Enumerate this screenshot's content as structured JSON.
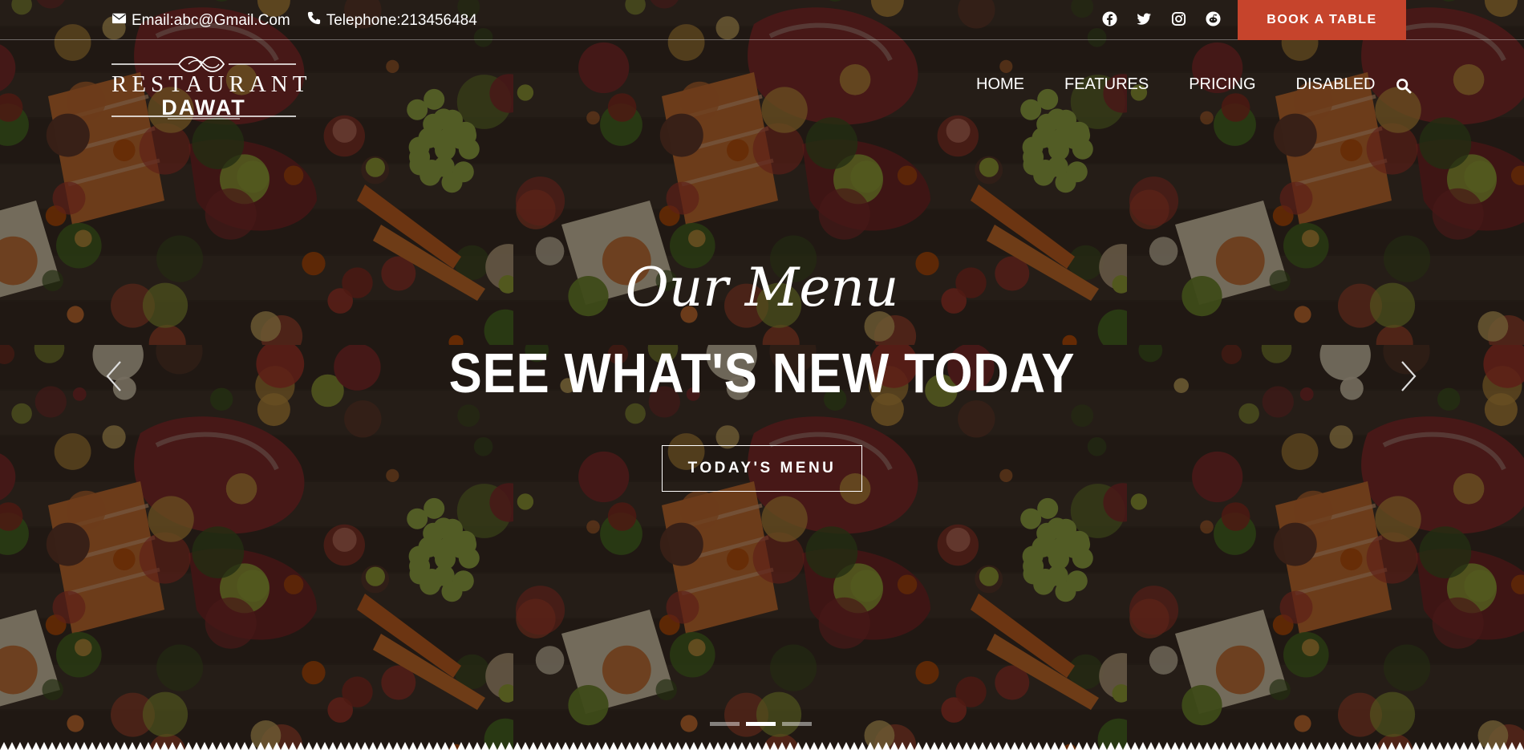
{
  "topbar": {
    "email_label": "Email:abc@Gmail.Com",
    "phone_label": "Telephone:213456484",
    "socials": [
      "facebook-icon",
      "twitter-icon",
      "instagram-icon",
      "reddit-icon"
    ],
    "book_label": "BOOK A TABLE"
  },
  "logo": {
    "line1": "RESTAURANT",
    "line2": "DAWAT"
  },
  "nav": {
    "items": [
      "HOME",
      "FEATURES",
      "PRICING",
      "DISABLED"
    ]
  },
  "hero": {
    "subtitle": "Our Menu",
    "title": "SEE WHAT'S NEW TODAY",
    "button_label": "TODAY'S MENU"
  },
  "carousel": {
    "slide_count": 3,
    "active_slide": 2
  },
  "colors": {
    "accent": "#c6442c",
    "text": "#ffffff"
  }
}
